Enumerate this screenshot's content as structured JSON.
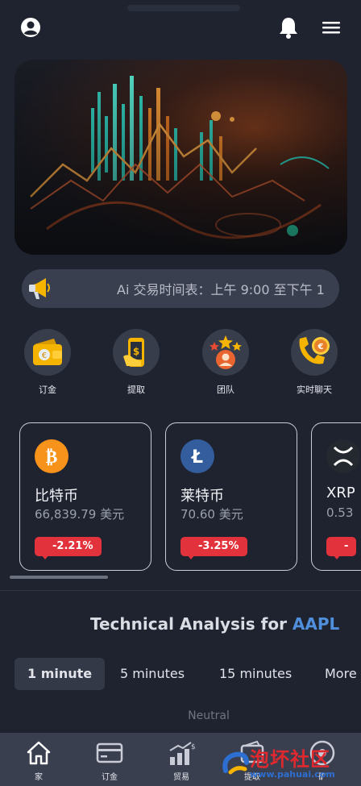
{
  "header": {
    "profile_icon": "user-circle-icon",
    "notification_icon": "bell-icon",
    "menu_icon": "hamburger-menu-icon"
  },
  "hero": {
    "image": "trading-chart-illustration"
  },
  "announcement": {
    "icon": "megaphone-icon",
    "text": "Ai 交易时间表：上午 9:00 至下午 1"
  },
  "quick_actions": [
    {
      "label": "订金",
      "icon": "wallet-icon"
    },
    {
      "label": "提取",
      "icon": "phone-cash-icon"
    },
    {
      "label": "团队",
      "icon": "team-stars-icon"
    },
    {
      "label": "实时聊天",
      "icon": "phone-chat-icon"
    }
  ],
  "markets": [
    {
      "name": "比特币",
      "price": "66,839.79 美元",
      "change": "-2.21%",
      "icon": "bitcoin-icon",
      "color": "#f7931a"
    },
    {
      "name": "莱特币",
      "price": "70.60 美元",
      "change": "-3.25%",
      "icon": "litecoin-icon",
      "color": "#345d9d"
    },
    {
      "name": "XRP",
      "price": "0.53",
      "change": "-",
      "icon": "xrp-icon",
      "color": "#23292f"
    }
  ],
  "analysis": {
    "title_prefix": "Technical Analysis for ",
    "symbol": "AAPL",
    "tabs": [
      "1 minute",
      "5 minutes",
      "15 minutes",
      "More"
    ],
    "active_tab": "1 minute",
    "summary": "Neutral"
  },
  "bottom_nav": [
    {
      "label": "家",
      "icon": "home-icon"
    },
    {
      "label": "订金",
      "icon": "card-icon"
    },
    {
      "label": "贸易",
      "icon": "trade-chart-icon"
    },
    {
      "label": "提取",
      "icon": "withdraw-icon"
    },
    {
      "label": "矿",
      "icon": "mining-icon"
    }
  ],
  "watermark": {
    "text": "泡坏社区",
    "url": "www.pahuai.com"
  },
  "colors": {
    "background": "#1f2330",
    "surface": "#3a3f50",
    "negative": "#e2323b",
    "accent_link": "#4f8fdc",
    "gold": "#f5b400"
  }
}
